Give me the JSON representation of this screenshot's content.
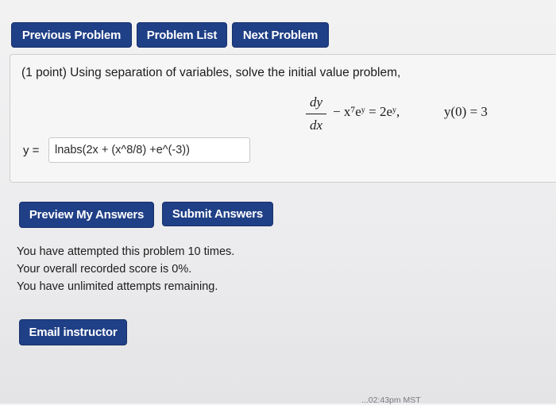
{
  "nav": {
    "previous_label": "Previous Problem",
    "list_label": "Problem List",
    "next_label": "Next Problem"
  },
  "problem": {
    "prompt": "(1 point) Using separation of variables, solve the initial value problem,",
    "equation": {
      "frac_num": "dy",
      "frac_den": "dx",
      "rest": "− x⁷eʸ = 2eʸ,",
      "initial_condition": "y(0) = 3"
    },
    "answer_label": "y =",
    "answer_value": "lnabs(2x + (x^8/8) +e^(-3))"
  },
  "actions": {
    "preview_label": "Preview My Answers",
    "submit_label": "Submit Answers",
    "email_label": "Email instructor"
  },
  "status": {
    "attempts": "You have attempted this problem 10 times.",
    "score": "Your overall recorded score is 0%.",
    "remaining": "You have unlimited attempts remaining."
  },
  "footer": {
    "timestamp": "...02:43pm MST"
  },
  "colors": {
    "button_blue": "#1f3f86",
    "background": "#efeff0"
  }
}
